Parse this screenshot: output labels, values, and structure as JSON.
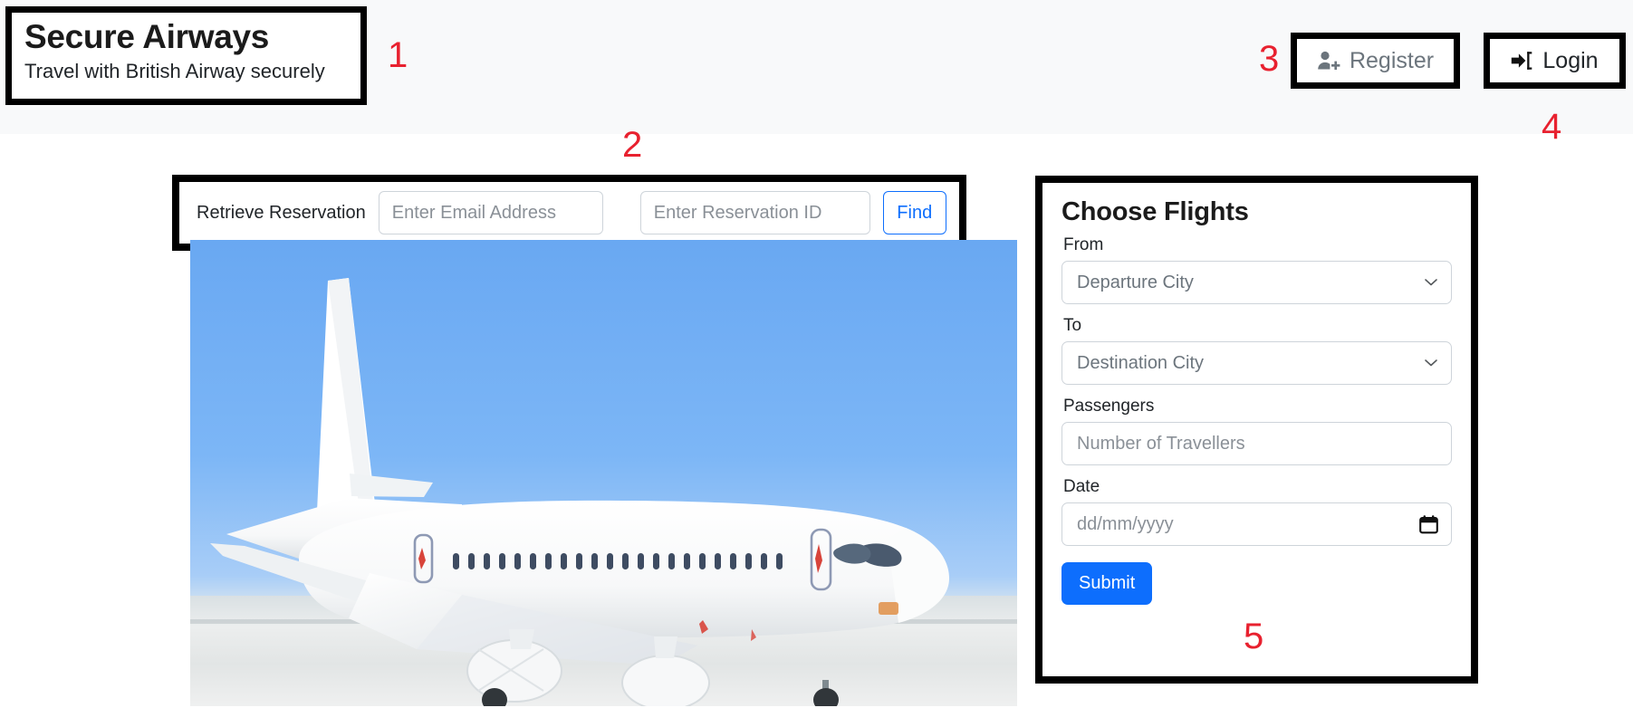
{
  "header": {
    "brand_title": "Secure Airways",
    "brand_subtitle": "Travel with British Airway securely",
    "register_label": "Register",
    "register_icon": "person-plus-icon",
    "login_label": "Login",
    "login_icon": "sign-in-icon"
  },
  "reservation": {
    "label": "Retrieve Reservation",
    "email_placeholder": "Enter Email Address",
    "email_value": "",
    "reservation_id_placeholder": "Enter Reservation ID",
    "reservation_id_value": "",
    "find_label": "Find"
  },
  "hero": {
    "alt": "white passenger airplane parked on runway under blue sky"
  },
  "flights": {
    "title": "Choose Flights",
    "from_label": "From",
    "from_selected": "Departure City",
    "from_options": [
      "Departure City"
    ],
    "to_label": "To",
    "to_selected": "Destination City",
    "to_options": [
      "Destination City"
    ],
    "passengers_label": "Passengers",
    "passengers_placeholder": "Number of Travellers",
    "passengers_value": "",
    "date_label": "Date",
    "date_placeholder": "dd/mm/yyyy",
    "date_value": "",
    "submit_label": "Submit",
    "chevron_icon": "chevron-down-icon",
    "calendar_icon": "calendar-icon"
  },
  "annotations": {
    "one": "1",
    "two": "2",
    "three": "3",
    "four": "4",
    "five": "5"
  },
  "colors": {
    "primary": "#0d6efd",
    "annotation_red": "#e8212f",
    "header_bg": "#f8f9fa",
    "muted_text": "#6c757d",
    "outline_black": "#000000"
  }
}
